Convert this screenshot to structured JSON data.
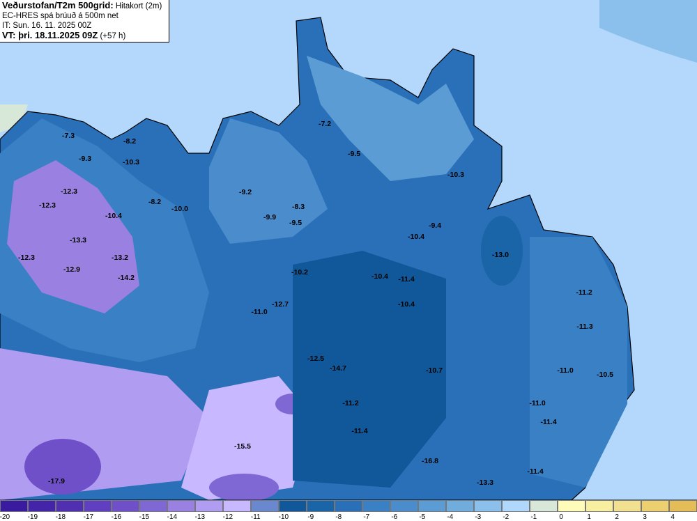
{
  "header": {
    "title": "Veðurstofan/T2m 500grid:",
    "subtitle": "Hitakort (2m)",
    "model": "EC-HRES spá brúuð á 500m net",
    "init_time": "IT: Sun. 16. 11. 2025 00Z",
    "valid_label": "VT: þri. 18.11.2025 09Z",
    "lead": "(+57 h)"
  },
  "map_labels": [
    "-7.3",
    "-9.3",
    "-8.2",
    "-10.3",
    "-12.3",
    "-12.3",
    "-10.4",
    "-8.2",
    "-10.0",
    "-13.3",
    "-12.3",
    "-12.9",
    "-13.2",
    "-14.2",
    "-7.2",
    "-9.5",
    "-9.2",
    "-8.3",
    "-9.9",
    "-9.5",
    "-10.3",
    "-9.4",
    "-10.4",
    "-13.0",
    "-10.2",
    "-10.4",
    "-11.4",
    "-12.7",
    "-11.0",
    "-10.4",
    "-11.2",
    "-11.3",
    "-12.5",
    "-14.7",
    "-10.7",
    "-11.0",
    "-10.5",
    "-11.2",
    "-11.0",
    "-11.4",
    "-11.4",
    "-15.5",
    "-16.8",
    "-17.9",
    "-13.3",
    "-11.4"
  ],
  "legend": {
    "ticks": [
      "-20",
      "-19",
      "-18",
      "-17",
      "-16",
      "-15",
      "-14",
      "-13",
      "-12",
      "-11",
      "-10",
      "-9",
      "-8",
      "-7",
      "-6",
      "-5",
      "-4",
      "-3",
      "-2",
      "-1",
      "0",
      "1",
      "2",
      "3",
      "4"
    ],
    "colors": [
      "#3a1a9e",
      "#4424a8",
      "#5030b0",
      "#6040c0",
      "#7050c8",
      "#8068d4",
      "#9a80e0",
      "#b09cf0",
      "#c8b8ff",
      "#6a88d0",
      "#10589a",
      "#1a64a8",
      "#2a70b8",
      "#3a80c4",
      "#4a8ccc",
      "#5c9cd4",
      "#70acdc",
      "#8cc0ec",
      "#b0d8fc",
      "#d8e8d8",
      "#fefcb8",
      "#f8eea0",
      "#f0e090",
      "#ecd070",
      "#e4bc58"
    ]
  }
}
